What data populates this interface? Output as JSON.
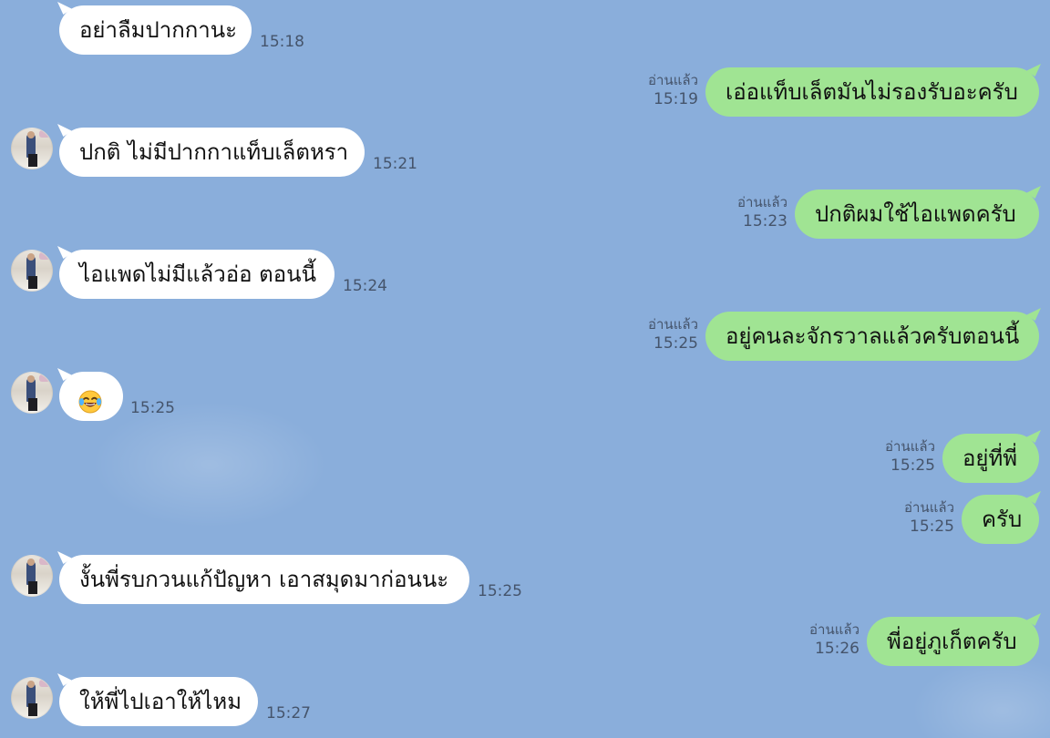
{
  "messages": [
    {
      "side": "in",
      "text": "อย่าลืมปากกานะ",
      "time": "15:18",
      "avatar": false
    },
    {
      "side": "out",
      "text": "เอ่อแท็บเล็ตมันไม่รองรับอะครับ",
      "time": "15:19",
      "read": "อ่านแล้ว"
    },
    {
      "side": "in",
      "text": "ปกติ ไม่มีปากกาแท็บเล็ตหรา",
      "time": "15:21",
      "avatar": true
    },
    {
      "side": "out",
      "text": "ปกติผมใช้ไอแพดครับ",
      "time": "15:23",
      "read": "อ่านแล้ว"
    },
    {
      "side": "in",
      "text": "ไอแพดไม่มีแล้วอ่อ ตอนนี้",
      "time": "15:24",
      "avatar": true
    },
    {
      "side": "out",
      "text": "อยู่คนละจักรวาลแล้วครับตอนนี้",
      "time": "15:25",
      "read": "อ่านแล้ว"
    },
    {
      "side": "in",
      "text": "",
      "emoji": "face-with-tears-of-joy-icon",
      "time": "15:25",
      "avatar": true
    },
    {
      "side": "out",
      "text": "อยู่ที่พี่",
      "time": "15:25",
      "read": "อ่านแล้ว"
    },
    {
      "side": "out",
      "text": "ครับ",
      "time": "15:25",
      "read": "อ่านแล้ว"
    },
    {
      "side": "in",
      "text": "งั้นพี่รบกวนแก้ปัญหา เอาสมุดมาก่อนนะ",
      "time": "15:25",
      "avatar": true
    },
    {
      "side": "out",
      "text": "พี่อยู่ภูเก็ตครับ",
      "time": "15:26",
      "read": "อ่านแล้ว"
    },
    {
      "side": "in",
      "text": "ให้พี่ไปเอาให้ไหม",
      "time": "15:27",
      "avatar": true
    }
  ],
  "colors": {
    "background": "#8aaedb",
    "incoming_bubble": "#ffffff",
    "outgoing_bubble": "#a0e493",
    "meta_text": "#45546b"
  }
}
